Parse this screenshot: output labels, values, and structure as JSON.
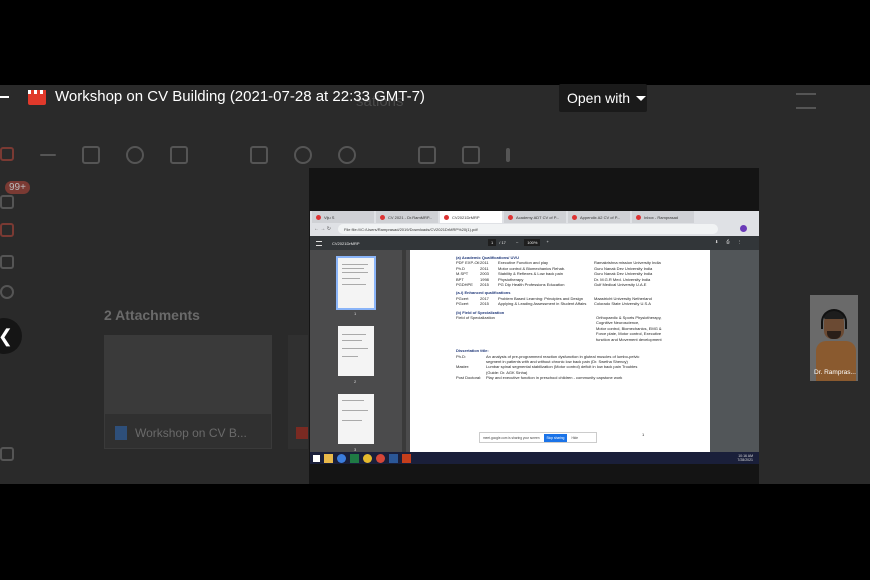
{
  "header": {
    "title": "Workshop on CV Building (2021-07-28 at 22:33 GMT-7)",
    "open_with": "Open with"
  },
  "gmail": {
    "search_hint": "sations",
    "badge": "99+",
    "attachments_title": "2 Attachments",
    "attachment_name": "Workshop on CV B..."
  },
  "shared_screen": {
    "tabs": [
      "Viju S",
      "CV 2021 - Dr.RamMRP...",
      "CV2021DrMRP",
      "Academy ADT CV of P...",
      "Appendix A2 CV of P...",
      "Inbox - Ramprasad"
    ],
    "address": "File   file:///C:/Users/Ramprasad/2019/Downloads/CV2021DrMRP%20(1).pdf",
    "pdf_filename": "CV2021DrMRP",
    "page_current": "1",
    "page_total": "/ 17",
    "zoom": "100%",
    "thumb_nums": [
      "1",
      "2",
      "3"
    ],
    "pdf": {
      "section1": "(a) Academic Qualifications/ UVU",
      "academic_rows": [
        [
          "PDF EXP-Oil",
          "2011",
          "Executive Function and play",
          "Ramakrishna mission University India"
        ],
        [
          "Ph.D",
          "2011",
          "Motor control & Biomechanics Rehab.",
          "Guru Nanak Dev University India"
        ],
        [
          "M.SPT",
          "2003",
          "Stability & Reflexes & Low back pain",
          "Guru Nanak Dev University India"
        ],
        [
          "BPT",
          "1998",
          "Physiotherapy",
          "Dr. M.G.R Med. University  India"
        ],
        [
          "PGDHPE",
          "2015",
          "PG Dip Health Professions Education",
          "Gulf Medical University        U.A.E"
        ]
      ],
      "section2": "(a-i) Enhanced qualifications",
      "enhanced_rows": [
        [
          "PGcert",
          "2017",
          "Problem Based Learning: Principles and Design",
          "Maastricht University   Netherland"
        ],
        [
          "PGcert",
          "2015",
          "Applying & Leading Assessment in Student Affairs",
          "Colorado State University     U.S.A"
        ]
      ],
      "section3": "(b) Field of Specialization",
      "spec_label": "Field of Specialization",
      "spec_lines": [
        "Orthopaedic & Sports Physiotherapy,",
        "Cognitive Neuroscience,",
        "Motor control, Biomechanics, EMG &",
        "Force plate, Motor control, Executive",
        "function and Movement development"
      ],
      "diss_title": "Dissertation title:",
      "diss_rows": [
        [
          "Ph.D:",
          "An analysis of pre-programmed reaction dysfunction in gluteal muscles of lumbo-pelvic segment in patients with and without chronic low back pain (Dr. Swetha Shenoy)"
        ],
        [
          "Master:",
          "Lumbar spinal segmental stabilization (Motor control) deficit in low back pain Troubles (Guide: Dr. AGK Sinha)"
        ],
        [
          "Post Doctoral:",
          "Play and executive function in preschool children - community capstone work"
        ]
      ],
      "page_number": "1"
    },
    "share_msg": "meet.google.com is sharing your screen",
    "stop_sharing": "Stop sharing",
    "hide": "Hide",
    "clock_time": "10:16 AM",
    "clock_date": "7/28/2021"
  },
  "participant": {
    "name": "Dr. Rampras..."
  }
}
